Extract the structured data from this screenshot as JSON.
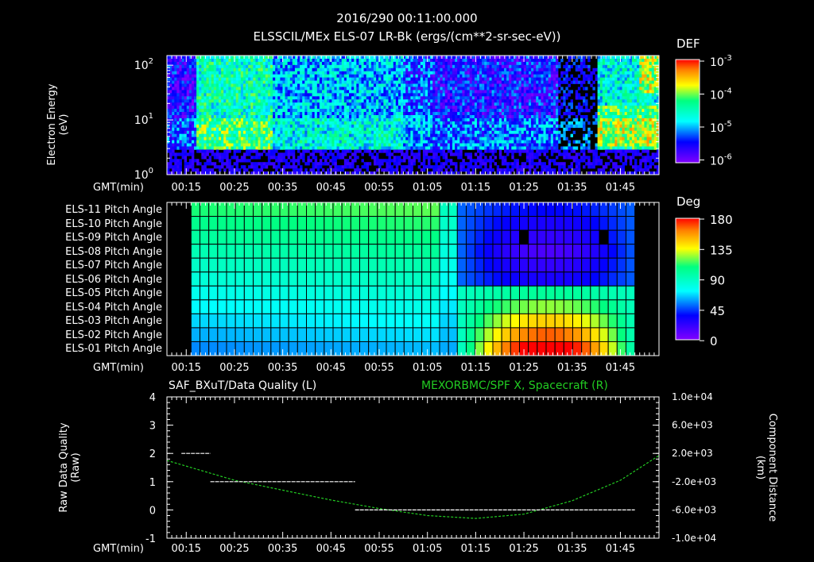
{
  "header": {
    "timestamp": "2016/290 00:11:00.000",
    "subtitle": "ELSSCIL/MEx ELS-07 LR-Bk   (ergs/(cm**2-sr-sec-eV))"
  },
  "time_ticks": [
    "00:15",
    "00:25",
    "00:35",
    "00:45",
    "00:55",
    "01:05",
    "01:15",
    "01:25",
    "01:35",
    "01:45"
  ],
  "gmt_label": "GMT(min)",
  "panel1": {
    "ylabel_line1": "Electron Energy",
    "ylabel_line2": "(eV)",
    "y_ticks": [
      {
        "base": "10",
        "exp": "2"
      },
      {
        "base": "10",
        "exp": "1"
      },
      {
        "base": "10",
        "exp": "0"
      }
    ],
    "colorbar_title": "DEF",
    "colorbar_ticks": [
      {
        "base": "10",
        "exp": "-3"
      },
      {
        "base": "10",
        "exp": "-4"
      },
      {
        "base": "10",
        "exp": "-5"
      },
      {
        "base": "10",
        "exp": "-6"
      }
    ]
  },
  "panel2": {
    "rows": [
      "ELS-11 Pitch Angle",
      "ELS-10 Pitch Angle",
      "ELS-09 Pitch Angle",
      "ELS-08 Pitch Angle",
      "ELS-07 Pitch Angle",
      "ELS-06 Pitch Angle",
      "ELS-05 Pitch Angle",
      "ELS-04 Pitch Angle",
      "ELS-03 Pitch Angle",
      "ELS-02 Pitch Angle",
      "ELS-01 Pitch Angle"
    ],
    "colorbar_title": "Deg",
    "colorbar_ticks": [
      "180",
      "135",
      "90",
      "45",
      "0"
    ]
  },
  "panel3": {
    "title_left": "SAF_BXuT/Data Quality (L)",
    "title_right": "MEXORBMC/SPF X, Spacecraft (R)",
    "ylabel_left_1": "Raw Data Quality",
    "ylabel_left_2": "(Raw)",
    "ylabel_right_1": "Component Distance",
    "ylabel_right_2": "(km)",
    "left_ticks": [
      "4",
      "3",
      "2",
      "1",
      "0",
      "-1"
    ],
    "right_ticks": [
      "1.0e+04",
      "6.0e+03",
      "2.0e+03",
      "-2.0e+03",
      "-6.0e+03",
      "-1.0e+04"
    ],
    "colors": {
      "spacecraft_x": "#22cc22",
      "quality": "#ffffff"
    }
  },
  "chart_data": [
    {
      "type": "heatmap",
      "title": "ELSSCIL/MEx ELS-07 LR-Bk   (ergs/(cm**2-sr-sec-eV))",
      "ylabel": "Electron Energy (eV)",
      "y_scale": "log",
      "ylim": [
        1,
        150
      ],
      "colorbar": {
        "label": "DEF",
        "scale": "log",
        "range": [
          1e-06,
          0.001
        ]
      }
    },
    {
      "type": "heatmap",
      "categories": [
        "ELS-11",
        "ELS-10",
        "ELS-09",
        "ELS-08",
        "ELS-07",
        "ELS-06",
        "ELS-05",
        "ELS-04",
        "ELS-03",
        "ELS-02",
        "ELS-01"
      ],
      "colorbar": {
        "label": "Deg",
        "range": [
          0,
          180
        ]
      }
    },
    {
      "type": "line",
      "series": [
        {
          "name": "SAF_BXuT/Data Quality (L)",
          "axis": "left",
          "segments": [
            {
              "x_range": [
                "00:14",
                "00:20"
              ],
              "value": 2
            },
            {
              "x_range": [
                "00:20",
                "00:50"
              ],
              "value": 1
            },
            {
              "x_range": [
                "00:50",
                "01:48"
              ],
              "value": 0
            }
          ]
        },
        {
          "name": "MEXORBMC/SPF X, Spacecraft (R)",
          "axis": "right",
          "x": [
            "00:11",
            "00:25",
            "00:35",
            "00:45",
            "00:55",
            "01:05",
            "01:15",
            "01:25",
            "01:35",
            "01:45",
            "01:53"
          ],
          "y": [
            1000,
            -1800,
            -3200,
            -4600,
            -5800,
            -6800,
            -7200,
            -6600,
            -4700,
            -1800,
            1700
          ]
        }
      ],
      "ylim_left": [
        -1,
        4
      ],
      "ylim_right": [
        -10000,
        10000
      ]
    }
  ]
}
